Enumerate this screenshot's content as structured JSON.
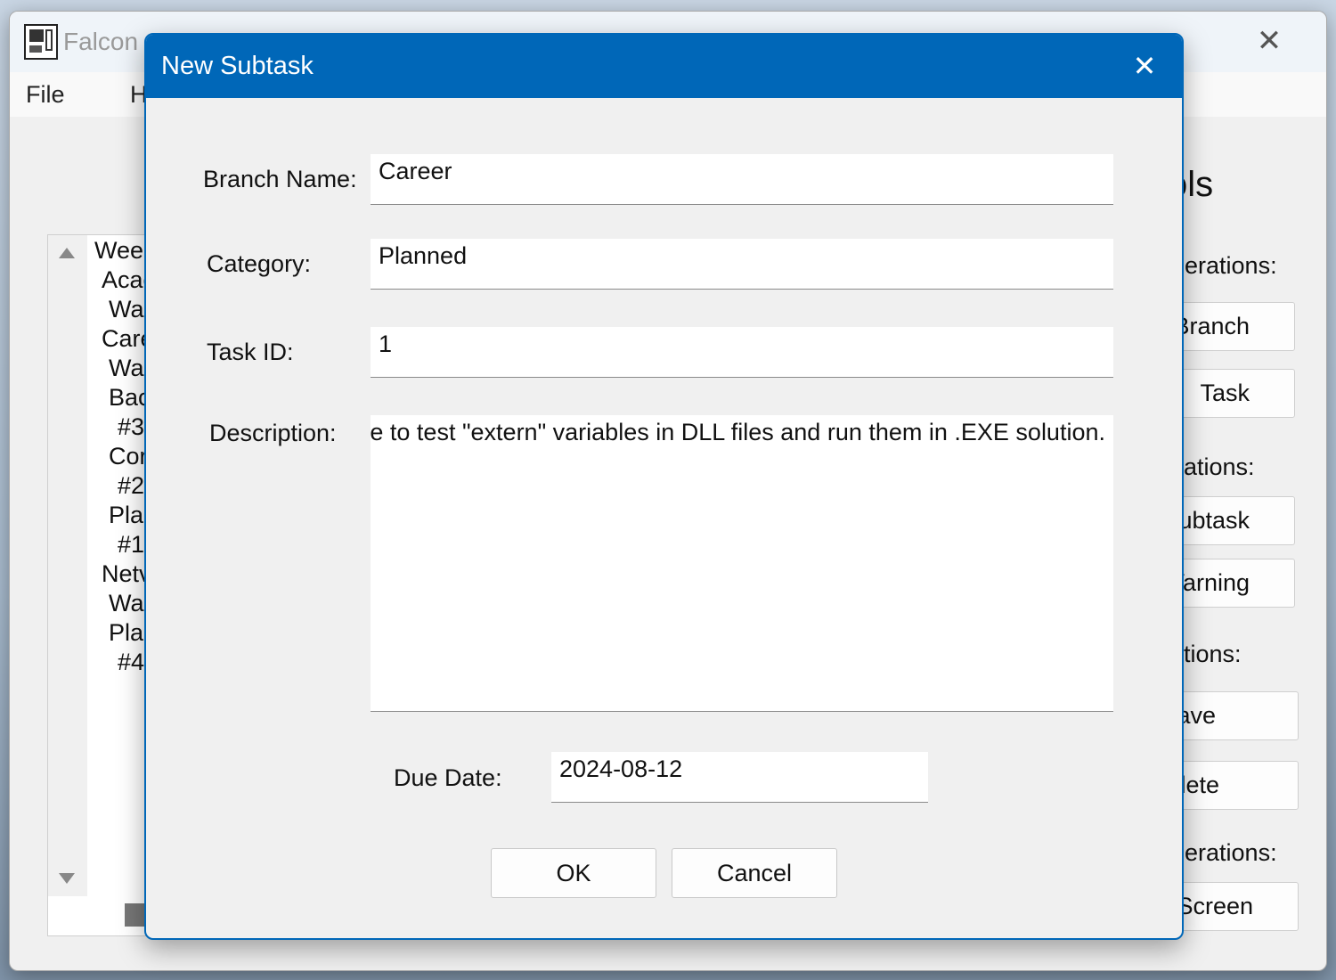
{
  "main_window": {
    "title": "Falcon",
    "close_glyph": "✕",
    "menu": [
      "File",
      "H"
    ]
  },
  "tree": {
    "items": [
      "Weel",
      "Acac",
      "War",
      "Care",
      "War",
      "Bac",
      "#3",
      "Cor",
      "#2",
      "Plar",
      "#1",
      "Netv",
      "War",
      "Plar",
      "#4"
    ]
  },
  "tools": {
    "title": "ols",
    "sections": [
      "perations:",
      "ations:",
      "tions:",
      "perations:"
    ],
    "buttons": [
      "Branch",
      "Task",
      "ubtask",
      "Varning",
      "ave",
      "lete",
      "Screen"
    ]
  },
  "dialog": {
    "title": "New Subtask",
    "close_glyph": "✕",
    "fields": {
      "branch_name": {
        "label": "Branch Name:",
        "value": "Career"
      },
      "category": {
        "label": "Category:",
        "value": "Planned"
      },
      "task_id": {
        "label": "Task ID:",
        "value": "1"
      },
      "description": {
        "label": "Description:",
        "value": "e to test \"extern\" variables in DLL files and run them in .EXE solution."
      },
      "due_date": {
        "label": "Due Date:",
        "value": "2024-08-12"
      }
    },
    "ok_label": "OK",
    "cancel_label": "Cancel"
  },
  "colors": {
    "accent": "#0067b8",
    "window_bg": "#f0f0f0",
    "input_bg": "#ffffff"
  }
}
